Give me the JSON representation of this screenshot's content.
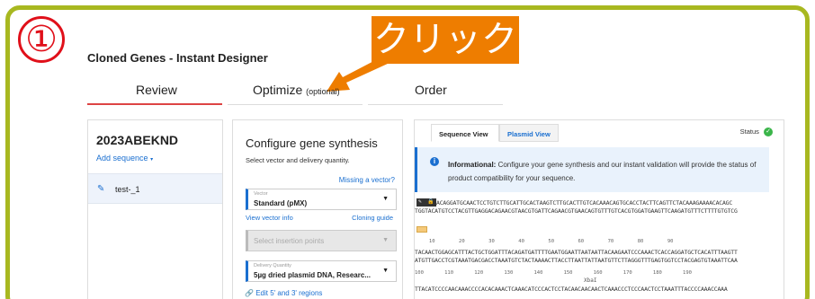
{
  "overlay": {
    "step_number": "①",
    "callout_text": "クリック"
  },
  "app": {
    "title": "Cloned Genes - Instant Designer"
  },
  "steps": [
    {
      "label": "Review",
      "suffix": ""
    },
    {
      "label": "Optimize",
      "suffix": "(optional)"
    },
    {
      "label": "Order",
      "suffix": ""
    }
  ],
  "left_panel": {
    "order_id": "2023ABEKND",
    "add_sequence": "Add sequence",
    "items": [
      {
        "label": "test-_1"
      }
    ]
  },
  "configure": {
    "title": "Configure gene synthesis",
    "subtitle": "Select vector and delivery quantity.",
    "missing_vector": "Missing a vector?",
    "vector": {
      "label": "Vector",
      "value": "Standard (pMX)"
    },
    "view_vector_info": "View vector info",
    "cloning_guide": "Cloning guide",
    "insertion": {
      "placeholder": "Select insertion points"
    },
    "delivery": {
      "label": "Delivery Quantity",
      "value": "5µg dried plasmid DNA, Researc..."
    },
    "edit_regions": "Edit 5' and 3' regions"
  },
  "viewer": {
    "tabs": [
      {
        "label": "Sequence View"
      },
      {
        "label": "Plasmid View"
      }
    ],
    "status_label": "Status",
    "info": {
      "title": "Informational:",
      "message": "Configure your gene synthesis and our instant validation will provide the status of product compatibility for your sequence."
    },
    "sequence": {
      "line1": "ACAGGATGCAACTCCTGTCTTGCATTGCACTAAGTCTTGCACTTGTCACAAACAGTGCACCTACTTCAGTTCTACAAAGAAAACACAGC",
      "line2": "TGGTACATGTCCTACGTTGAGGACAGAACGTAACGTGATTCAGAACGTGAACAGTGTTTGTCACGTGGATGAAGTTCAAGATGTTTCTTTTGTGTCG",
      "ruler1": "   10        20        30        40        50        60        70        80        90",
      "line3": "TACAACTGGAGCATTTACTGCTGGATTTACAGATGATTTTGAATGGAATTAATAATTACAAGAATCCCAAACTCACCAGGATGCTCACATTTAAGTT",
      "line4": "ATGTTGACCTCGTAAATGACGACCTAAATGTCTACTAAAACTTACCTTAATTATTAATGTTCTTAGGGTTTGAGTGGTCCTACGAGTGTAAATTCAA",
      "ruler2": "100       110       120       130       140       150       160       170       180       190",
      "feature": "XbaI",
      "line5": "TTACATCCCCAACAAACCCCACACAAACTCAAACATCCCACTCCTACAACAACAACTCAAACCCTCCCAACTCCTAAATTTACCCCAAACCAAA"
    }
  },
  "colors": {
    "frame": "#a8b820",
    "callout": "#ee7d00",
    "step_marker": "#e0101a",
    "link": "#1a6fd0",
    "status_ok": "#3bb54a"
  }
}
